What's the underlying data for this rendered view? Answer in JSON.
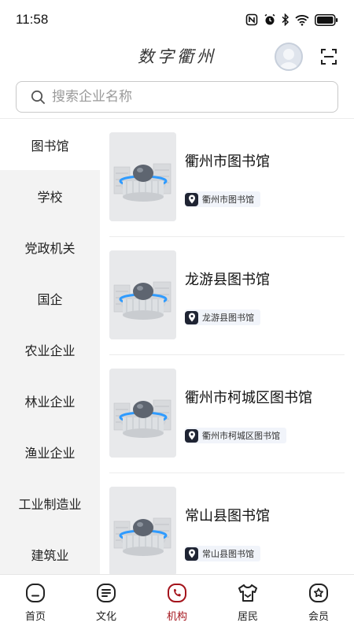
{
  "status_bar": {
    "time": "11:58",
    "icons": [
      "nfc-icon",
      "alarm-icon",
      "bluetooth-icon",
      "wifi-icon",
      "battery-icon"
    ]
  },
  "header": {
    "title": "数字衢州",
    "avatar_icon": "user-avatar-icon",
    "scan_icon": "scan-icon"
  },
  "search": {
    "placeholder": "搜索企业名称",
    "value": "",
    "icon": "search-icon"
  },
  "sidebar": {
    "active_index": 0,
    "items": [
      {
        "label": "图书馆"
      },
      {
        "label": "学校"
      },
      {
        "label": "党政机关"
      },
      {
        "label": "国企"
      },
      {
        "label": "农业企业"
      },
      {
        "label": "林业企业"
      },
      {
        "label": "渔业企业"
      },
      {
        "label": "工业制造业"
      },
      {
        "label": "建筑业"
      }
    ]
  },
  "institutions": [
    {
      "name": "衢州市图书馆",
      "location": "衢州市图书馆"
    },
    {
      "name": "龙游县图书馆",
      "location": "龙游县图书馆"
    },
    {
      "name": "衢州市柯城区图书馆",
      "location": "衢州市柯城区图书馆"
    },
    {
      "name": "常山县图书馆",
      "location": "常山县图书馆"
    }
  ],
  "tabbar": {
    "active_index": 2,
    "accent_color": "#a4131b",
    "items": [
      {
        "label": "首页",
        "icon": "home-icon"
      },
      {
        "label": "文化",
        "icon": "culture-icon"
      },
      {
        "label": "机构",
        "icon": "institution-icon"
      },
      {
        "label": "居民",
        "icon": "residents-icon"
      },
      {
        "label": "会员",
        "icon": "member-icon"
      }
    ]
  }
}
